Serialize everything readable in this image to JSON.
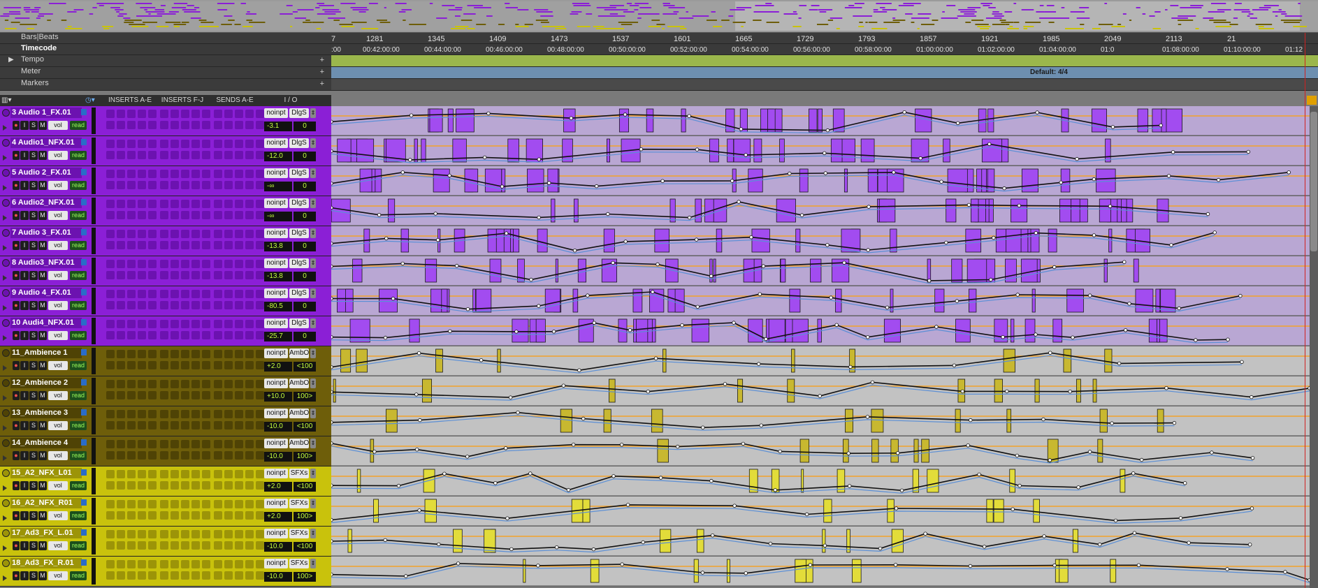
{
  "colors": {
    "purple": "#8b1fd6",
    "purple_dark": "#6c12b0",
    "olive": "#6e5e0a",
    "olive_dark": "#4f4305",
    "yellow": "#c9c20c",
    "yellow_dark": "#9c9408",
    "tempo": "#9bb74c",
    "meter": "#6d8fb0",
    "lane_purple": "#b9a7d3",
    "lane_gray": "#c2c2c2",
    "auto_orange": "#f2a22a",
    "auto_blue": "#5b8fd6"
  },
  "rulers": {
    "bars_beats_label": "Bars|Beats",
    "timecode_label": "Timecode",
    "tempo_label": "Tempo",
    "meter_label": "Meter",
    "markers_label": "Markers",
    "meter_value": "Default: 4/4",
    "bars": [
      "7",
      "1281",
      "1345",
      "1409",
      "1473",
      "1537",
      "1601",
      "1665",
      "1729",
      "1793",
      "1857",
      "1921",
      "1985",
      "2049",
      "2113",
      "21"
    ],
    "timecodes": [
      ":00",
      "00:42:00:00",
      "00:44:00:00",
      "00:46:00:00",
      "00:48:00:00",
      "00:50:00:00",
      "00:52:00:00",
      "00:54:00:00",
      "00:56:00:00",
      "00:58:00:00",
      "01:00:00:00",
      "01:02:00:00",
      "01:04:00:00",
      "01:0",
      "01:08:00:00",
      "01:10:00:00",
      "01:12"
    ]
  },
  "columns": {
    "inserts_ae": "INSERTS A-E",
    "inserts_fj": "INSERTS F-J",
    "sends_ae": "SENDS A-E",
    "io": "I / O"
  },
  "track_buttons": {
    "input": "I",
    "solo": "S",
    "mute": "M",
    "view": "vol",
    "mode": "read"
  },
  "tracks": [
    {
      "name": "3 Audio 1_FX.01",
      "input": "noinpt",
      "output": "DlgS",
      "volume": "-3.1",
      "pan": "0",
      "color": "purple"
    },
    {
      "name": "4 Audio1_NFX.01",
      "input": "noinpt",
      "output": "DlgS",
      "volume": "-12.0",
      "pan": "0",
      "color": "purple"
    },
    {
      "name": "5 Audio 2_FX.01",
      "input": "noinpt",
      "output": "DlgS",
      "volume": "-∞",
      "pan": "0",
      "color": "purple"
    },
    {
      "name": "6 Audio2_NFX.01",
      "input": "noinpt",
      "output": "DlgS",
      "volume": "-∞",
      "pan": "0",
      "color": "purple"
    },
    {
      "name": "7 Audio 3_FX.01",
      "input": "noinpt",
      "output": "DlgS",
      "volume": "-13.8",
      "pan": "0",
      "color": "purple"
    },
    {
      "name": "8 Audio3_NFX.01",
      "input": "noinpt",
      "output": "DlgS",
      "volume": "-13.8",
      "pan": "0",
      "color": "purple"
    },
    {
      "name": "9 Audio 4_FX.01",
      "input": "noinpt",
      "output": "DlgS",
      "volume": "-80.5",
      "pan": "0",
      "color": "purple"
    },
    {
      "name": "10 Audi4_NFX.01",
      "input": "noinpt",
      "output": "DlgS",
      "volume": "-25.7",
      "pan": "0",
      "color": "purple"
    },
    {
      "name": "11_Ambience 1",
      "input": "noinpt",
      "output": "AmbO",
      "volume": "+2.0",
      "pan": "<100",
      "color": "olive"
    },
    {
      "name": "12_Ambience 2",
      "input": "noinpt",
      "output": "AmbO",
      "volume": "+10.0",
      "pan": "100>",
      "color": "olive"
    },
    {
      "name": "13_Ambience 3",
      "input": "noinpt",
      "output": "AmbO",
      "volume": "-10.0",
      "pan": "<100",
      "color": "olive"
    },
    {
      "name": "14_Ambience 4",
      "input": "noinpt",
      "output": "AmbO",
      "volume": "-10.0",
      "pan": "100>",
      "color": "olive"
    },
    {
      "name": "15_A2_NFX_L01",
      "input": "noinpt",
      "output": "SFXs",
      "volume": "+2.0",
      "pan": "<100",
      "color": "yellow"
    },
    {
      "name": "16_A2_NFX_R01",
      "input": "noinpt",
      "output": "SFXs",
      "volume": "+2.0",
      "pan": "100>",
      "color": "yellow"
    },
    {
      "name": "17_Ad3_FX_L.01",
      "input": "noinpt",
      "output": "SFXs",
      "volume": "-10.0",
      "pan": "<100",
      "color": "yellow"
    },
    {
      "name": "18_Ad3_FX_R.01",
      "input": "noinpt",
      "output": "SFXs",
      "volume": "-10.0",
      "pan": "100>",
      "color": "yellow"
    }
  ]
}
